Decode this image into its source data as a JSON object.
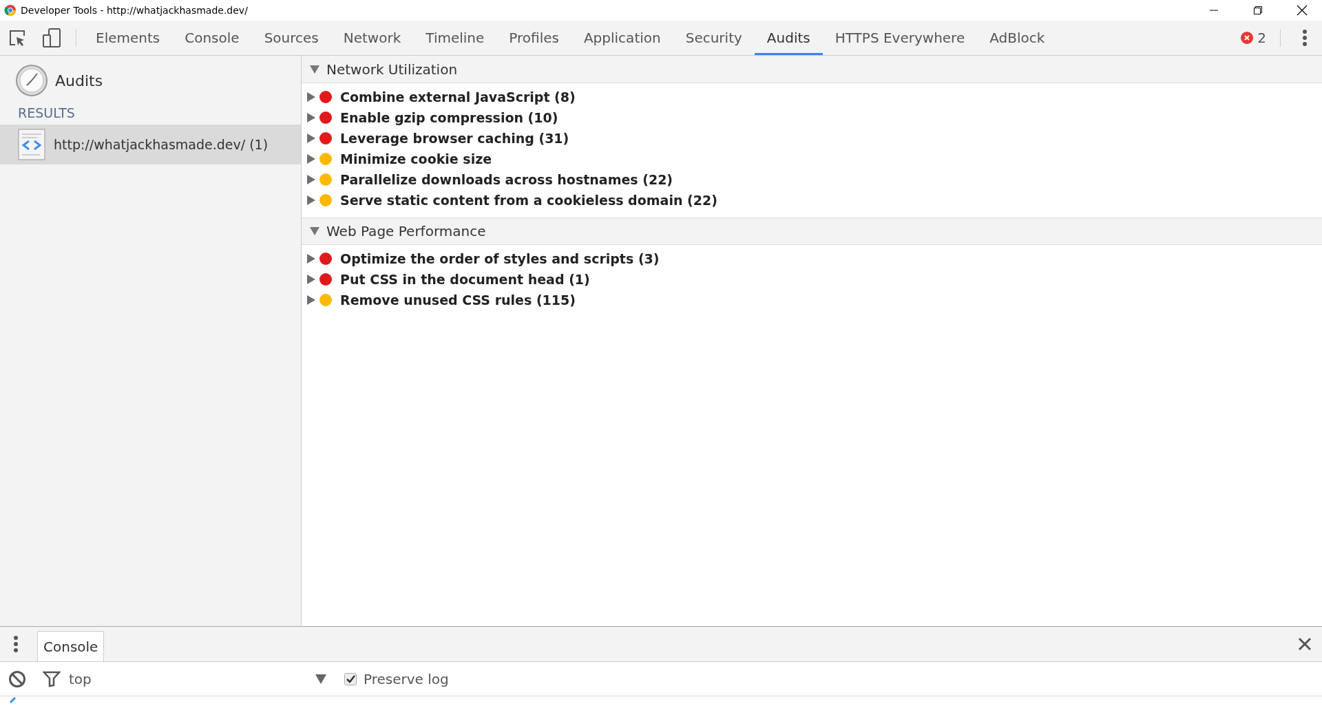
{
  "window": {
    "title": "Developer Tools - http://whatjackhasmade.dev/"
  },
  "tabs": [
    {
      "label": "Elements",
      "selected": false
    },
    {
      "label": "Console",
      "selected": false
    },
    {
      "label": "Sources",
      "selected": false
    },
    {
      "label": "Network",
      "selected": false
    },
    {
      "label": "Timeline",
      "selected": false
    },
    {
      "label": "Profiles",
      "selected": false
    },
    {
      "label": "Application",
      "selected": false
    },
    {
      "label": "Security",
      "selected": false
    },
    {
      "label": "Audits",
      "selected": true
    },
    {
      "label": "HTTPS Everywhere",
      "selected": false
    },
    {
      "label": "AdBlock",
      "selected": false
    }
  ],
  "error_count": "2",
  "sidebar": {
    "title": "Audits",
    "section": "RESULTS",
    "items": [
      {
        "label": "http://whatjackhasmade.dev/ (1)",
        "selected": true
      }
    ]
  },
  "categories": [
    {
      "title": "Network Utilization",
      "expanded": true,
      "items": [
        {
          "label": "Combine external JavaScript (8)",
          "color": "#e0191c",
          "expanded": false
        },
        {
          "label": "Enable gzip compression (10)",
          "color": "#e0191c",
          "expanded": false
        },
        {
          "label": "Leverage browser caching (31)",
          "color": "#e0191c",
          "expanded": false
        },
        {
          "label": "Minimize cookie size",
          "color": "#ffb800",
          "expanded": false
        },
        {
          "label": "Parallelize downloads across hostnames (22)",
          "color": "#ffb800",
          "expanded": false
        },
        {
          "label": "Serve static content from a cookieless domain (22)",
          "color": "#ffb800",
          "expanded": false
        }
      ]
    },
    {
      "title": "Web Page Performance",
      "expanded": true,
      "items": [
        {
          "label": "Optimize the order of styles and scripts (3)",
          "color": "#e0191c",
          "expanded": false
        },
        {
          "label": "Put CSS in the document head (1)",
          "color": "#e0191c",
          "expanded": false
        },
        {
          "label": "Remove unused CSS rules (115)",
          "color": "#ffb800",
          "expanded": false
        }
      ]
    }
  ],
  "drawer": {
    "tabs": [
      {
        "label": "Console",
        "selected": true
      }
    ],
    "context": "top",
    "preserve_log": {
      "label": "Preserve log",
      "checked": true
    }
  }
}
